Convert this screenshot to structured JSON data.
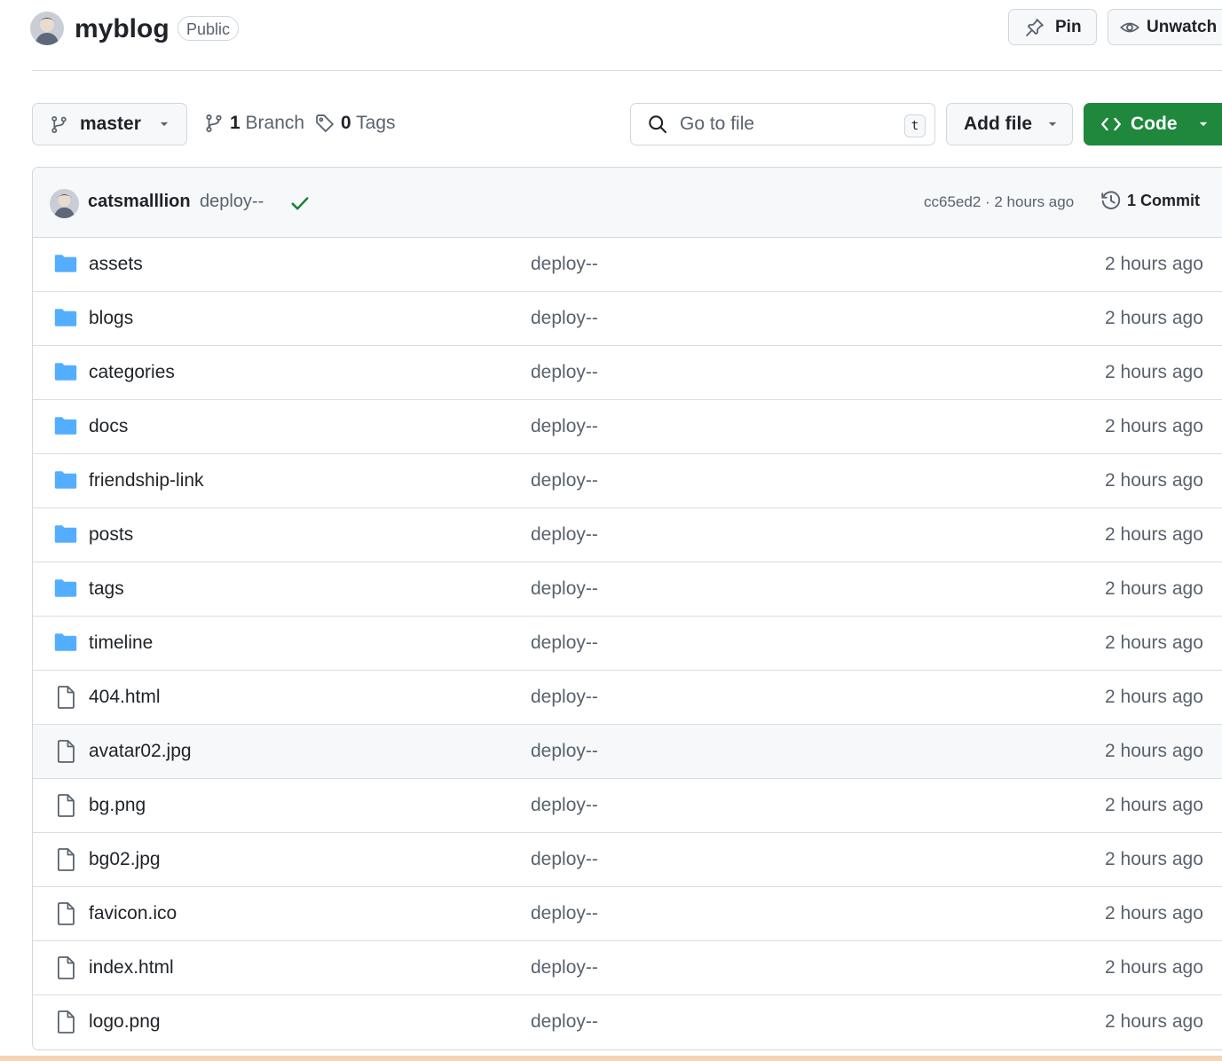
{
  "header": {
    "repo_name": "myblog",
    "visibility": "Public",
    "pin_label": "Pin",
    "watch_label": "Unwatch"
  },
  "toolbar": {
    "branch": "master",
    "branch_count": "1",
    "branch_label": "Branch",
    "tag_count": "0",
    "tag_label": "Tags",
    "search_placeholder": "Go to file",
    "search_shortcut": "t",
    "add_file_label": "Add file",
    "code_label": "Code"
  },
  "latest_commit": {
    "author": "catsmalllion",
    "message": "deploy--",
    "hash_time": "cc65ed2 · 2 hours ago",
    "commit_count": "1 Commit"
  },
  "files": [
    {
      "type": "folder",
      "icon": "folder-icon",
      "name": "assets",
      "message": "deploy--",
      "time": "2 hours ago"
    },
    {
      "type": "folder",
      "icon": "folder-icon",
      "name": "blogs",
      "message": "deploy--",
      "time": "2 hours ago"
    },
    {
      "type": "folder",
      "icon": "folder-icon",
      "name": "categories",
      "message": "deploy--",
      "time": "2 hours ago"
    },
    {
      "type": "folder",
      "icon": "folder-icon",
      "name": "docs",
      "message": "deploy--",
      "time": "2 hours ago"
    },
    {
      "type": "folder",
      "icon": "folder-icon",
      "name": "friendship-link",
      "message": "deploy--",
      "time": "2 hours ago"
    },
    {
      "type": "folder",
      "icon": "folder-icon",
      "name": "posts",
      "message": "deploy--",
      "time": "2 hours ago"
    },
    {
      "type": "folder",
      "icon": "folder-icon",
      "name": "tags",
      "message": "deploy--",
      "time": "2 hours ago"
    },
    {
      "type": "folder",
      "icon": "folder-icon",
      "name": "timeline",
      "message": "deploy--",
      "time": "2 hours ago"
    },
    {
      "type": "file",
      "icon": "file-icon",
      "name": "404.html",
      "message": "deploy--",
      "time": "2 hours ago"
    },
    {
      "type": "file",
      "icon": "file-icon",
      "name": "avatar02.jpg",
      "message": "deploy--",
      "time": "2 hours ago",
      "hovered": true
    },
    {
      "type": "file",
      "icon": "file-icon",
      "name": "bg.png",
      "message": "deploy--",
      "time": "2 hours ago"
    },
    {
      "type": "file",
      "icon": "file-icon",
      "name": "bg02.jpg",
      "message": "deploy--",
      "time": "2 hours ago"
    },
    {
      "type": "file",
      "icon": "file-icon",
      "name": "favicon.ico",
      "message": "deploy--",
      "time": "2 hours ago"
    },
    {
      "type": "file",
      "icon": "file-icon",
      "name": "index.html",
      "message": "deploy--",
      "time": "2 hours ago"
    },
    {
      "type": "file",
      "icon": "file-icon",
      "name": "logo.png",
      "message": "deploy--",
      "time": "2 hours ago"
    }
  ],
  "colors": {
    "folder": "#54aeff",
    "code_button": "#1f883d",
    "success_check": "#1a7f37",
    "muted_text": "#59636e"
  }
}
